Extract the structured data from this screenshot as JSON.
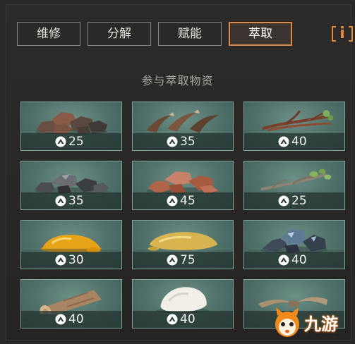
{
  "tabs": [
    {
      "label": "维修",
      "active": false
    },
    {
      "label": "分解",
      "active": false
    },
    {
      "label": "赋能",
      "active": false
    },
    {
      "label": "萃取",
      "active": true
    }
  ],
  "info_button": {
    "label": "i",
    "icon": "info-icon"
  },
  "section_title": "参与萃取物资",
  "materials": [
    {
      "item": "ore-chunks",
      "count": "25"
    },
    {
      "item": "claws",
      "count": "35"
    },
    {
      "item": "roots",
      "count": "40"
    },
    {
      "item": "dark-stones",
      "count": "35"
    },
    {
      "item": "red-stones",
      "count": "45"
    },
    {
      "item": "branch",
      "count": "25"
    },
    {
      "item": "amber-resin",
      "count": "30"
    },
    {
      "item": "gold-liquid",
      "count": "75"
    },
    {
      "item": "crystal-ore",
      "count": "40"
    },
    {
      "item": "wood-log",
      "count": "40"
    },
    {
      "item": "white-stone",
      "count": "40"
    },
    {
      "item": "horns",
      "count": ""
    }
  ],
  "level_icon": "chevron-circle-icon",
  "watermark": {
    "text": "九游"
  },
  "colors": {
    "accent": "#d98a4a",
    "card_bg": "#4f7069",
    "info_icon": "#e28b3b"
  }
}
